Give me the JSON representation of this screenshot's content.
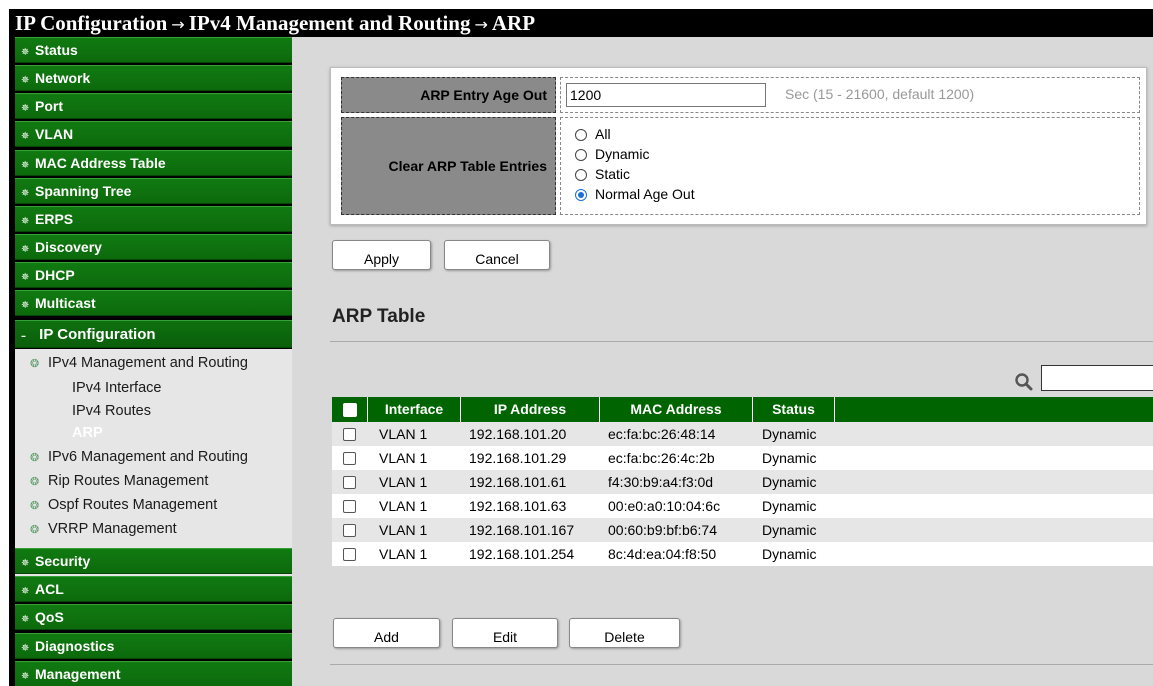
{
  "header": {
    "crumb1": "IP Configuration",
    "crumb2": "IPv4 Management and Routing",
    "crumb3": "ARP",
    "separator": "→"
  },
  "sidebar": {
    "items_top": [
      "Status",
      "Network",
      "Port",
      "VLAN",
      "MAC Address Table",
      "Spanning Tree",
      "ERPS",
      "Discovery",
      "DHCP",
      "Multicast"
    ],
    "open_item": "IP Configuration",
    "ipv4_group": "IPv4 Management and Routing",
    "ipv4_children": [
      "IPv4 Interface",
      "IPv4 Routes",
      "ARP"
    ],
    "other_groups": [
      "IPv6 Management and Routing",
      "Rip Routes Management",
      "Ospf Routes Management",
      "VRRP Management"
    ],
    "items_bottom": [
      "Security",
      "ACL",
      "QoS",
      "Diagnostics",
      "Management"
    ],
    "collapsed_mark": "✵",
    "expanded_mark": "–",
    "group_mark": "❂"
  },
  "config": {
    "age_label": "ARP Entry Age Out",
    "age_value": "1200",
    "age_hint": "Sec (15 - 21600, default 1200)",
    "clear_label": "Clear ARP Table Entries",
    "clear_options": [
      "All",
      "Dynamic",
      "Static",
      "Normal Age Out"
    ],
    "clear_selected": "Normal Age Out"
  },
  "buttons": {
    "apply": "Apply",
    "cancel": "Cancel",
    "add": "Add",
    "edit": "Edit",
    "delete": "Delete"
  },
  "arp_table": {
    "title": "ARP Table",
    "search_value": "",
    "columns": [
      "Interface",
      "IP Address",
      "MAC Address",
      "Status"
    ],
    "rows": [
      [
        "VLAN 1",
        "192.168.101.20",
        "ec:fa:bc:26:48:14",
        "Dynamic"
      ],
      [
        "VLAN 1",
        "192.168.101.29",
        "ec:fa:bc:26:4c:2b",
        "Dynamic"
      ],
      [
        "VLAN 1",
        "192.168.101.61",
        "f4:30:b9:a4:f3:0d",
        "Dynamic"
      ],
      [
        "VLAN 1",
        "192.168.101.63",
        "00:e0:a0:10:04:6c",
        "Dynamic"
      ],
      [
        "VLAN 1",
        "192.168.101.167",
        "00:60:b9:bf:b6:74",
        "Dynamic"
      ],
      [
        "VLAN 1",
        "192.168.101.254",
        "8c:4d:ea:04:f8:50",
        "Dynamic"
      ]
    ]
  },
  "colors": {
    "nav_green": "#117a11",
    "table_header": "#006400",
    "radio_selected": "#1a6fd8"
  },
  "icons": {
    "search": "search-icon"
  }
}
